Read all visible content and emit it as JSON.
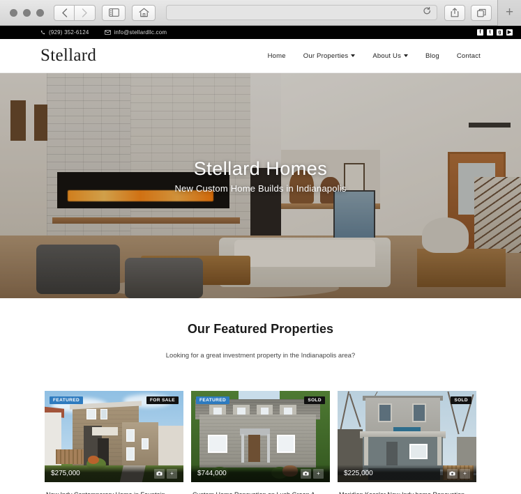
{
  "browser": {
    "url_placeholder": "",
    "url_value": "",
    "back_icon": "chevron-left-icon",
    "forward_icon": "chevron-right-icon",
    "sidebar_icon": "sidebar-icon",
    "home_icon": "home-icon",
    "reload_icon": "reload-icon",
    "share_icon": "share-icon",
    "tabs_icon": "tabs-icon",
    "newtab_label": "+"
  },
  "topbar": {
    "phone": "(929) 352-6124",
    "email": "info@stellardllc.com",
    "phone_icon": "phone-icon",
    "email_icon": "envelope-icon",
    "social": [
      {
        "name": "facebook-icon",
        "glyph": "f"
      },
      {
        "name": "twitter-icon",
        "glyph": "t"
      },
      {
        "name": "google-plus-icon",
        "glyph": "g"
      },
      {
        "name": "youtube-icon",
        "glyph": "▶"
      }
    ],
    "background": "#000000"
  },
  "header": {
    "logo": "Stellard",
    "nav": [
      {
        "label": "Home",
        "has_caret": false
      },
      {
        "label": "Our Properties",
        "has_caret": true
      },
      {
        "label": "About Us",
        "has_caret": true
      },
      {
        "label": "Blog",
        "has_caret": false
      },
      {
        "label": "Contact",
        "has_caret": false
      }
    ]
  },
  "hero": {
    "title": "Stellard Homes",
    "subtitle": "New Custom Home Builds in Indianapolis"
  },
  "featured": {
    "title": "Our Featured Properties",
    "subtitle": "Looking for a great investment property in the Indianapolis area?",
    "cards": [
      {
        "featured_badge": "FEATURED",
        "status_badge": "FOR SALE",
        "price": "$275,000",
        "title": "New Indy Contemporary Home in Fountain …",
        "camera_icon": "camera-icon",
        "plus_icon": "plus-icon"
      },
      {
        "featured_badge": "FEATURED",
        "status_badge": "SOLD",
        "price": "$744,000",
        "title": "Custom Home Renovation on Lush Green A…",
        "camera_icon": "camera-icon",
        "plus_icon": "plus-icon"
      },
      {
        "featured_badge": "",
        "status_badge": "SOLD",
        "price": "$225,000",
        "title": "Meridian Kessler New Indy home Renovation",
        "camera_icon": "camera-icon",
        "plus_icon": "plus-icon"
      }
    ]
  },
  "colors": {
    "featured_badge": "#2e7bbf",
    "status_badge": "#111111",
    "topbar_bg": "#000000",
    "text_dark": "#1a1a1a"
  }
}
